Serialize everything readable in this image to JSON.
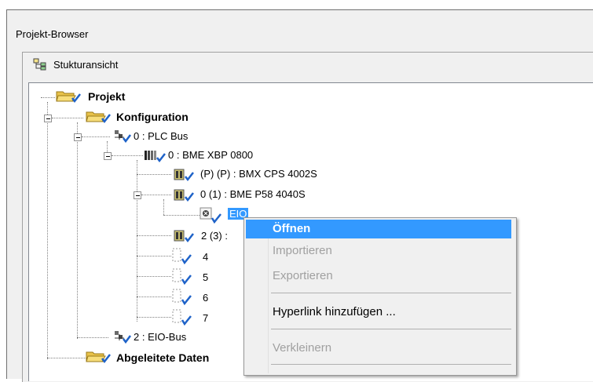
{
  "window": {
    "title": "Projekt-Browser"
  },
  "toolbar": {
    "view_label": "Stukturansicht",
    "view_icon": "tree-structure-icon"
  },
  "tree": {
    "root": "Projekt",
    "config": "Konfiguration",
    "plc_bus": "0 : PLC Bus",
    "rack": "0 : BME XBP 0800",
    "psu": "(P) (P) : BMX CPS 4002S",
    "cpu": "0 (1) : BME P58 4040S",
    "eio": "EIO",
    "slot2": "2 (3) :",
    "slot4": "4",
    "slot5": "5",
    "slot6": "6",
    "slot7": "7",
    "eio_bus": "2 : EIO-Bus",
    "derived": "Abgeleitete Daten"
  },
  "context_menu": {
    "open": "Öffnen",
    "import": "Importieren",
    "export": "Exportieren",
    "hyperlink": "Hyperlink hinzufügen ...",
    "minimize": "Verkleinern"
  },
  "colors": {
    "accent": "#3399ff",
    "folder": "#e8c24a",
    "check": "#1e62c8"
  }
}
